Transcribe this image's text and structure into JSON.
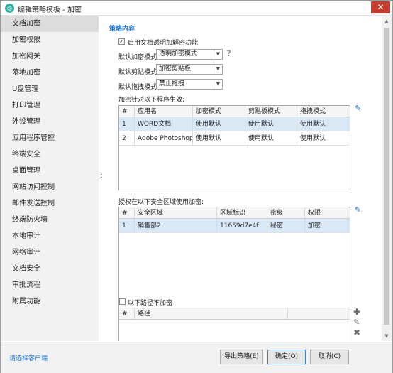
{
  "window": {
    "title": "编辑策略模板 - 加密",
    "app_icon_glyph": "◎"
  },
  "sidebar": {
    "items": [
      {
        "label": "文档加密",
        "active": true
      },
      {
        "label": "加密权限"
      },
      {
        "label": "加密网关"
      },
      {
        "label": "落地加密"
      },
      {
        "label": "U盘管理"
      },
      {
        "label": "打印管理"
      },
      {
        "label": "外设管理"
      },
      {
        "label": "应用程序管控"
      },
      {
        "label": "终端安全"
      },
      {
        "label": "桌面管理"
      },
      {
        "label": "网站访问控制"
      },
      {
        "label": "邮件发送控制"
      },
      {
        "label": "终端防火墙"
      },
      {
        "label": "本地审计"
      },
      {
        "label": "网络审计"
      },
      {
        "label": "文档安全"
      },
      {
        "label": "审批流程"
      },
      {
        "label": "附属功能"
      }
    ]
  },
  "policy": {
    "section_title": "策略内容",
    "enable_checkbox": {
      "label": "启用文档透明加解密功能",
      "checked": true
    },
    "default_encrypt_mode": {
      "label": "默认加密模式",
      "value": "透明加密模式"
    },
    "default_clipboard": {
      "label": "默认剪贴模式",
      "value": "加密剪贴板"
    },
    "default_drag": {
      "label": "默认拖拽模式",
      "value": "禁止拖拽"
    },
    "programs_caption": "加密针对以下程序生效:",
    "programs_table": {
      "columns": [
        "#",
        "应用名",
        "加密模式",
        "剪贴板模式",
        "拖拽模式"
      ],
      "rows": [
        [
          "1",
          "WORD文档",
          "使用默认",
          "使用默认",
          "使用默认"
        ],
        [
          "2",
          "Adobe Photoshop",
          "使用默认",
          "使用默认",
          "使用默认"
        ]
      ]
    },
    "zones_caption": "授权在以下安全区域使用加密:",
    "zones_table": {
      "columns": [
        "#",
        "安全区域",
        "区域标识",
        "密级",
        "权限"
      ],
      "rows": [
        [
          "1",
          "销售部2",
          "11659d7e4f",
          "秘密",
          "加密"
        ]
      ]
    },
    "path_checkbox": {
      "label": "以下路径不加密",
      "checked": false
    },
    "path_table": {
      "columns": [
        "#",
        "路径"
      ]
    }
  },
  "footer": {
    "client_link": "请选择客户端",
    "export_button": "导出策略(E)",
    "ok_button": "确定(O)",
    "cancel_button": "取消(C)"
  },
  "colors": {
    "accent": "#1a73c8",
    "close": "#c83c2e",
    "selected_row": "#d9e8f7"
  }
}
